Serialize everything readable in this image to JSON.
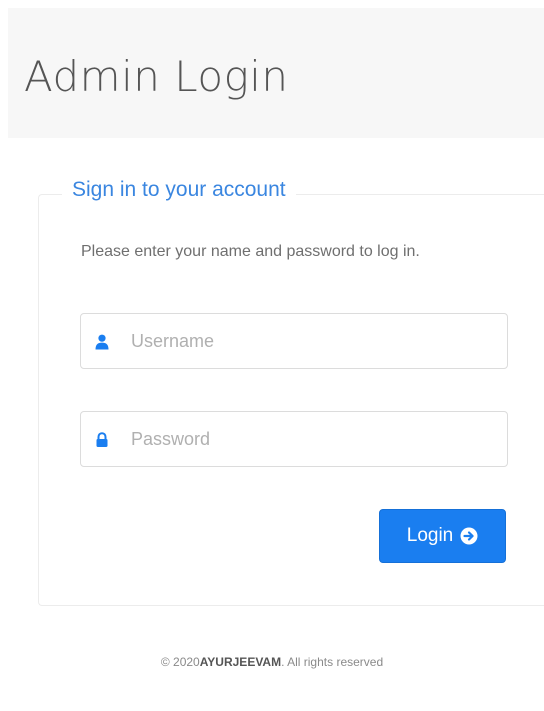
{
  "header": {
    "title": "Admin Login"
  },
  "login_form": {
    "legend": "Sign in to your account",
    "instructions": "Please enter your name and password to log in.",
    "username": {
      "placeholder": "Username",
      "value": "",
      "icon": "user-icon"
    },
    "password": {
      "placeholder": "Password",
      "value": "",
      "icon": "lock-icon"
    },
    "login_button": {
      "label": "Login",
      "icon": "arrow-circle-right-icon"
    }
  },
  "footer": {
    "prefix": "© 2020",
    "brand": "AYURJEEVAM",
    "suffix": ". All rights reserved"
  },
  "colors": {
    "accent": "#1a7ef0",
    "legend": "#3a86e0",
    "header_bg": "#f7f7f7"
  }
}
